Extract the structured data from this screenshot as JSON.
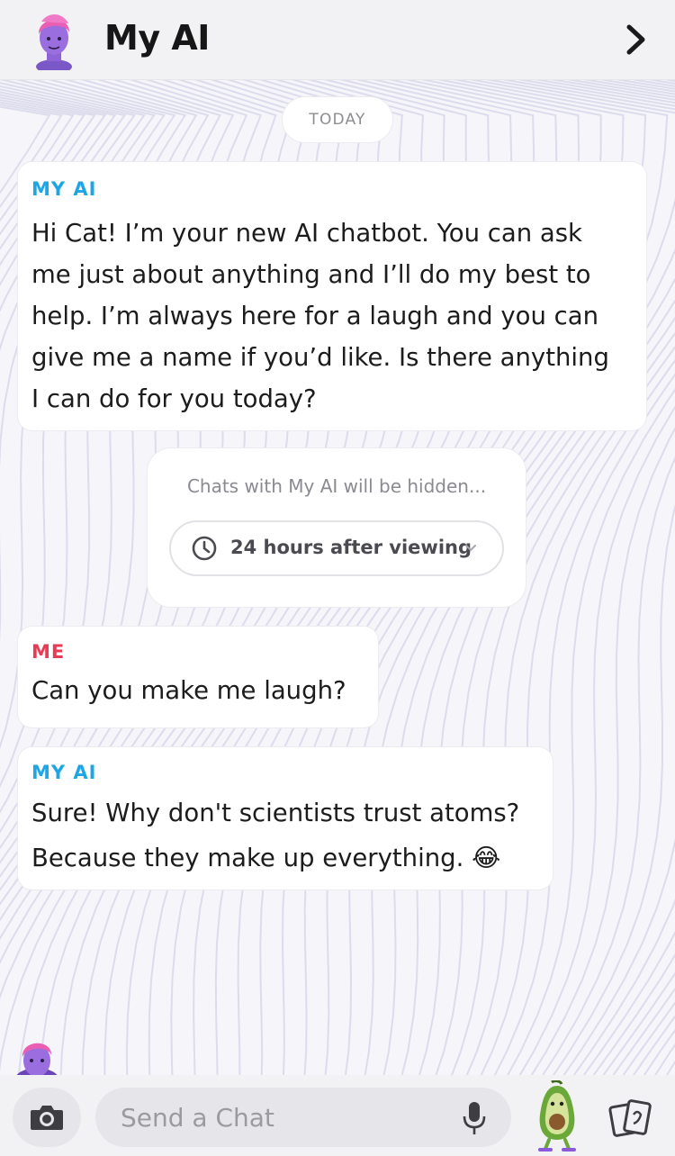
{
  "header": {
    "title": "My AI",
    "avatar_icon": "bitmoji-avatar-icon",
    "forward_icon": "chevron-right-icon"
  },
  "conversation": {
    "date_label": "TODAY",
    "messages": [
      {
        "sender": "MY AI",
        "lines": [
          "Hi Cat! I’m your new AI chatbot. You can ask",
          "me just about anything and I’ll do my best to",
          "help. I’m always here for a laugh and you can",
          "give me a name if you’d like. Is there anything",
          "I can do for you today?"
        ]
      },
      {
        "sender": "ME",
        "lines": [
          "Can you make me laugh?"
        ]
      },
      {
        "sender": "MY AI",
        "lines": [
          "Sure! Why don't scientists trust atoms?",
          "Because they make up everything. 😂"
        ]
      }
    ]
  },
  "hidden_notice": {
    "text": "Chats with My AI will be hidden...",
    "option": "24 hours after viewing",
    "option_icon": "clock-icon"
  },
  "composer": {
    "placeholder": "Send a Chat",
    "camera_icon": "camera-icon",
    "mic_icon": "microphone-icon",
    "bitmoji_icon": "avocado-bitmoji-icon",
    "cards_icon": "sticker-cards-icon"
  },
  "colors": {
    "ai_sender": "#1ea5e6",
    "me_sender": "#e63c55"
  }
}
